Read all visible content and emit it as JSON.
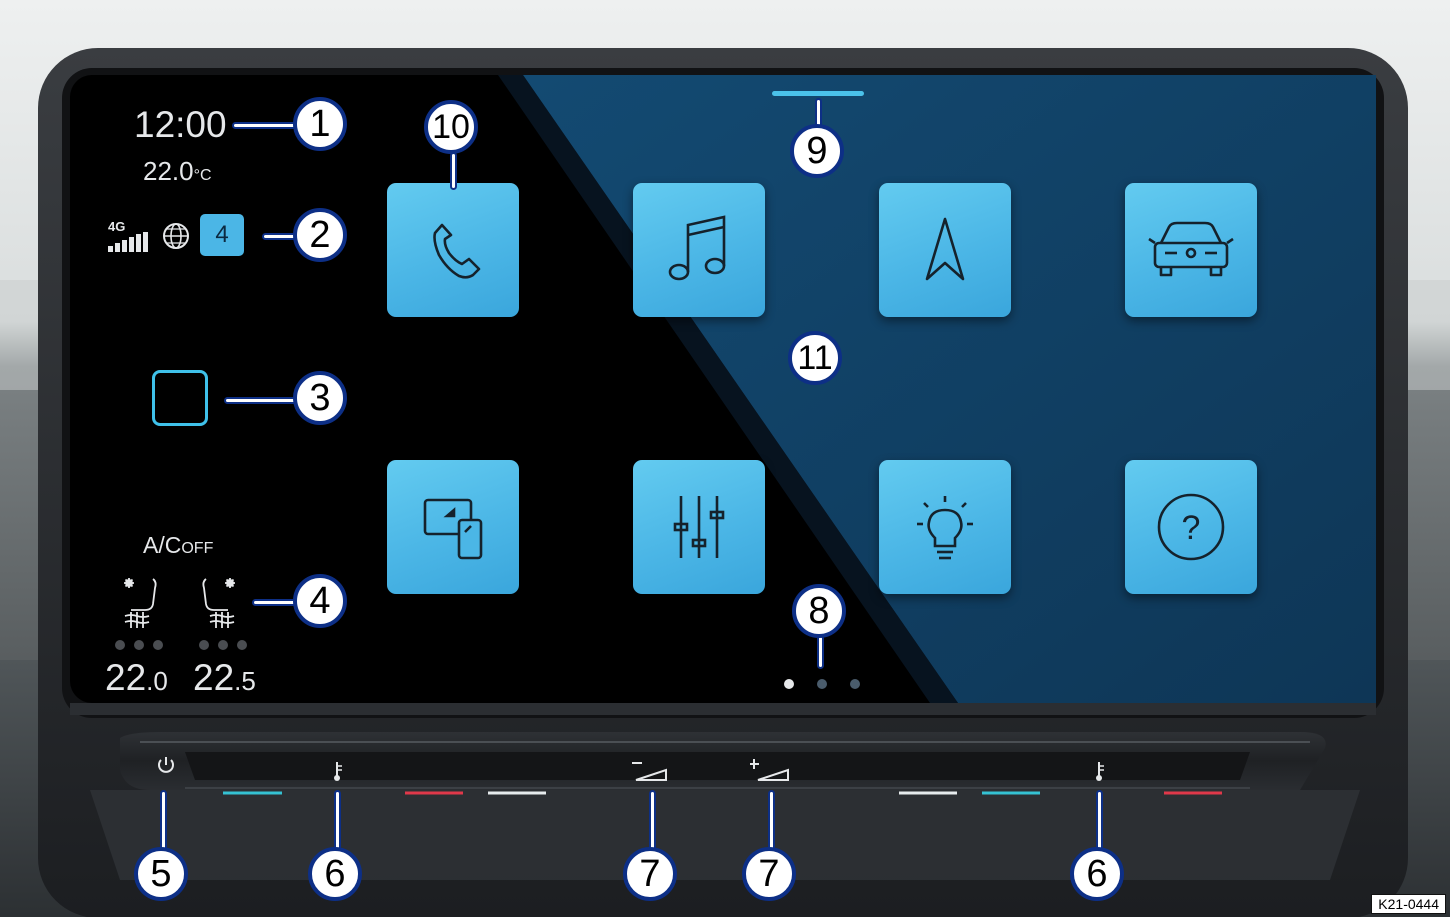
{
  "status": {
    "time": "12:00",
    "outside_temp_value": "22.0",
    "outside_temp_unit": "°C",
    "network_type": "4G",
    "notification_count": "4"
  },
  "climate": {
    "ac_label": "A/C",
    "ac_state": "OFF",
    "left_temp_main": "22",
    "left_temp_decimal": ".0",
    "right_temp_main": "22",
    "right_temp_decimal": ".5"
  },
  "app_tiles": [
    {
      "icon": "phone-icon"
    },
    {
      "icon": "music-icon"
    },
    {
      "icon": "navigation-icon"
    },
    {
      "icon": "car-icon"
    },
    {
      "icon": "app-connect-icon"
    },
    {
      "icon": "sound-equalizer-icon"
    },
    {
      "icon": "light-icon"
    },
    {
      "icon": "help-icon"
    }
  ],
  "pagination": {
    "pages": 3,
    "active": 1
  },
  "callouts": {
    "c1": "1",
    "c2": "2",
    "c3": "3",
    "c4": "4",
    "c5": "5",
    "c6a": "6",
    "c6b": "6",
    "c7a": "7",
    "c7b": "7",
    "c8": "8",
    "c9": "9",
    "c10": "10",
    "c11": "11"
  },
  "figure_ref": "K21-0444",
  "colors": {
    "tile_accent": "#4bb6e6",
    "callout_border": "#0d2f86",
    "slider_blue": "#35c2d3",
    "slider_red": "#e0384a"
  }
}
